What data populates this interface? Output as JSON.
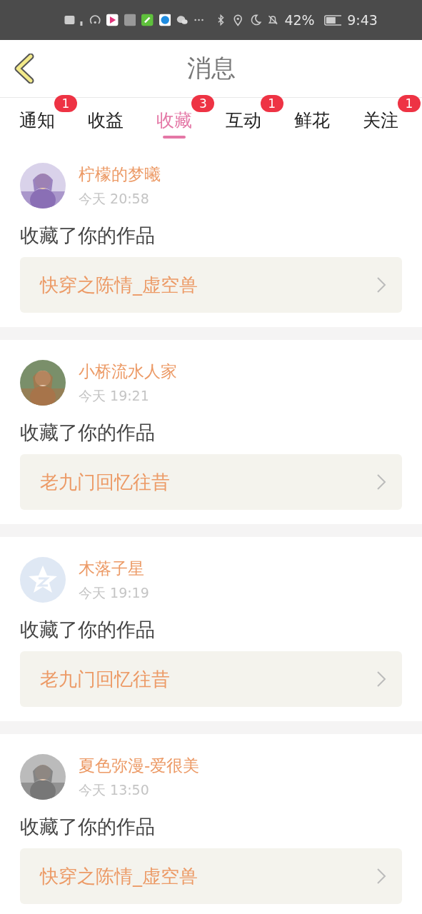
{
  "status_bar": {
    "battery": "42%",
    "time": "9:43"
  },
  "header": {
    "title": "消息"
  },
  "tabs": [
    {
      "label": "通知",
      "badge": "1",
      "selected": false
    },
    {
      "label": "收益",
      "selected": false
    },
    {
      "label": "收藏",
      "badge": "3",
      "selected": true
    },
    {
      "label": "互动",
      "badge": "1",
      "selected": false
    },
    {
      "label": "鲜花",
      "selected": false
    },
    {
      "label": "关注",
      "badge": "1",
      "selected": false
    }
  ],
  "messages": [
    {
      "name": "柠檬的梦曦",
      "time": "今天 20:58",
      "text": "收藏了你的作品",
      "work": "快穿之陈情_虚空兽"
    },
    {
      "name": "小桥流水人家",
      "time": "今天 19:21",
      "text": "收藏了你的作品",
      "work": "老九门回忆往昔"
    },
    {
      "avatar": {
        "kind": "default"
      },
      "name": "木落子星",
      "time": "今天 19:19",
      "text": "收藏了你的作品",
      "work": "老九门回忆往昔"
    },
    {
      "name": "夏色弥漫-爱很美",
      "time": "今天 13:50",
      "text": "收藏了你的作品",
      "work": "快穿之陈情_虚空兽"
    }
  ]
}
